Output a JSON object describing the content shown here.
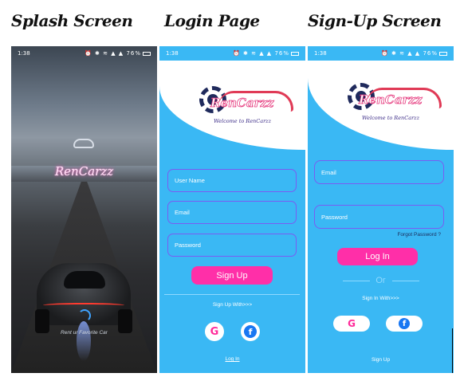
{
  "titles": {
    "splash": "Splash Screen",
    "login": "Login Page",
    "signup": "Sign-Up Screen"
  },
  "status": {
    "splash": "1:38",
    "login": "1:38",
    "signup": "1:38",
    "battery": "76%",
    "icons": "⏰ ✱ ≋ ▲ ▲"
  },
  "splash": {
    "brand": "RenCarzz",
    "tagline": "Rent ur Favorite Car"
  },
  "logo": {
    "word": "RenCarzz",
    "welcome": "Welcome to RenCarzz"
  },
  "login": {
    "username_placeholder": "User Name",
    "email_placeholder": "Email",
    "password_placeholder": "Password",
    "signup_button": "Sign Up",
    "signup_with": "Sign Up With>>>",
    "google": "G",
    "facebook": "f",
    "login_link": "Log In"
  },
  "signup": {
    "email_placeholder": "Email",
    "password_placeholder": "Password",
    "forgot_password": "Forgot Password ?",
    "login_button": "Log In",
    "or": "Or",
    "signin_with": "Sign In With>>>",
    "google": "G",
    "facebook": "f",
    "signup_link": "Sign Up"
  },
  "colors": {
    "blue": "#3ab8f4",
    "pink": "#ff2fa8",
    "purple": "#7a5cf2"
  }
}
